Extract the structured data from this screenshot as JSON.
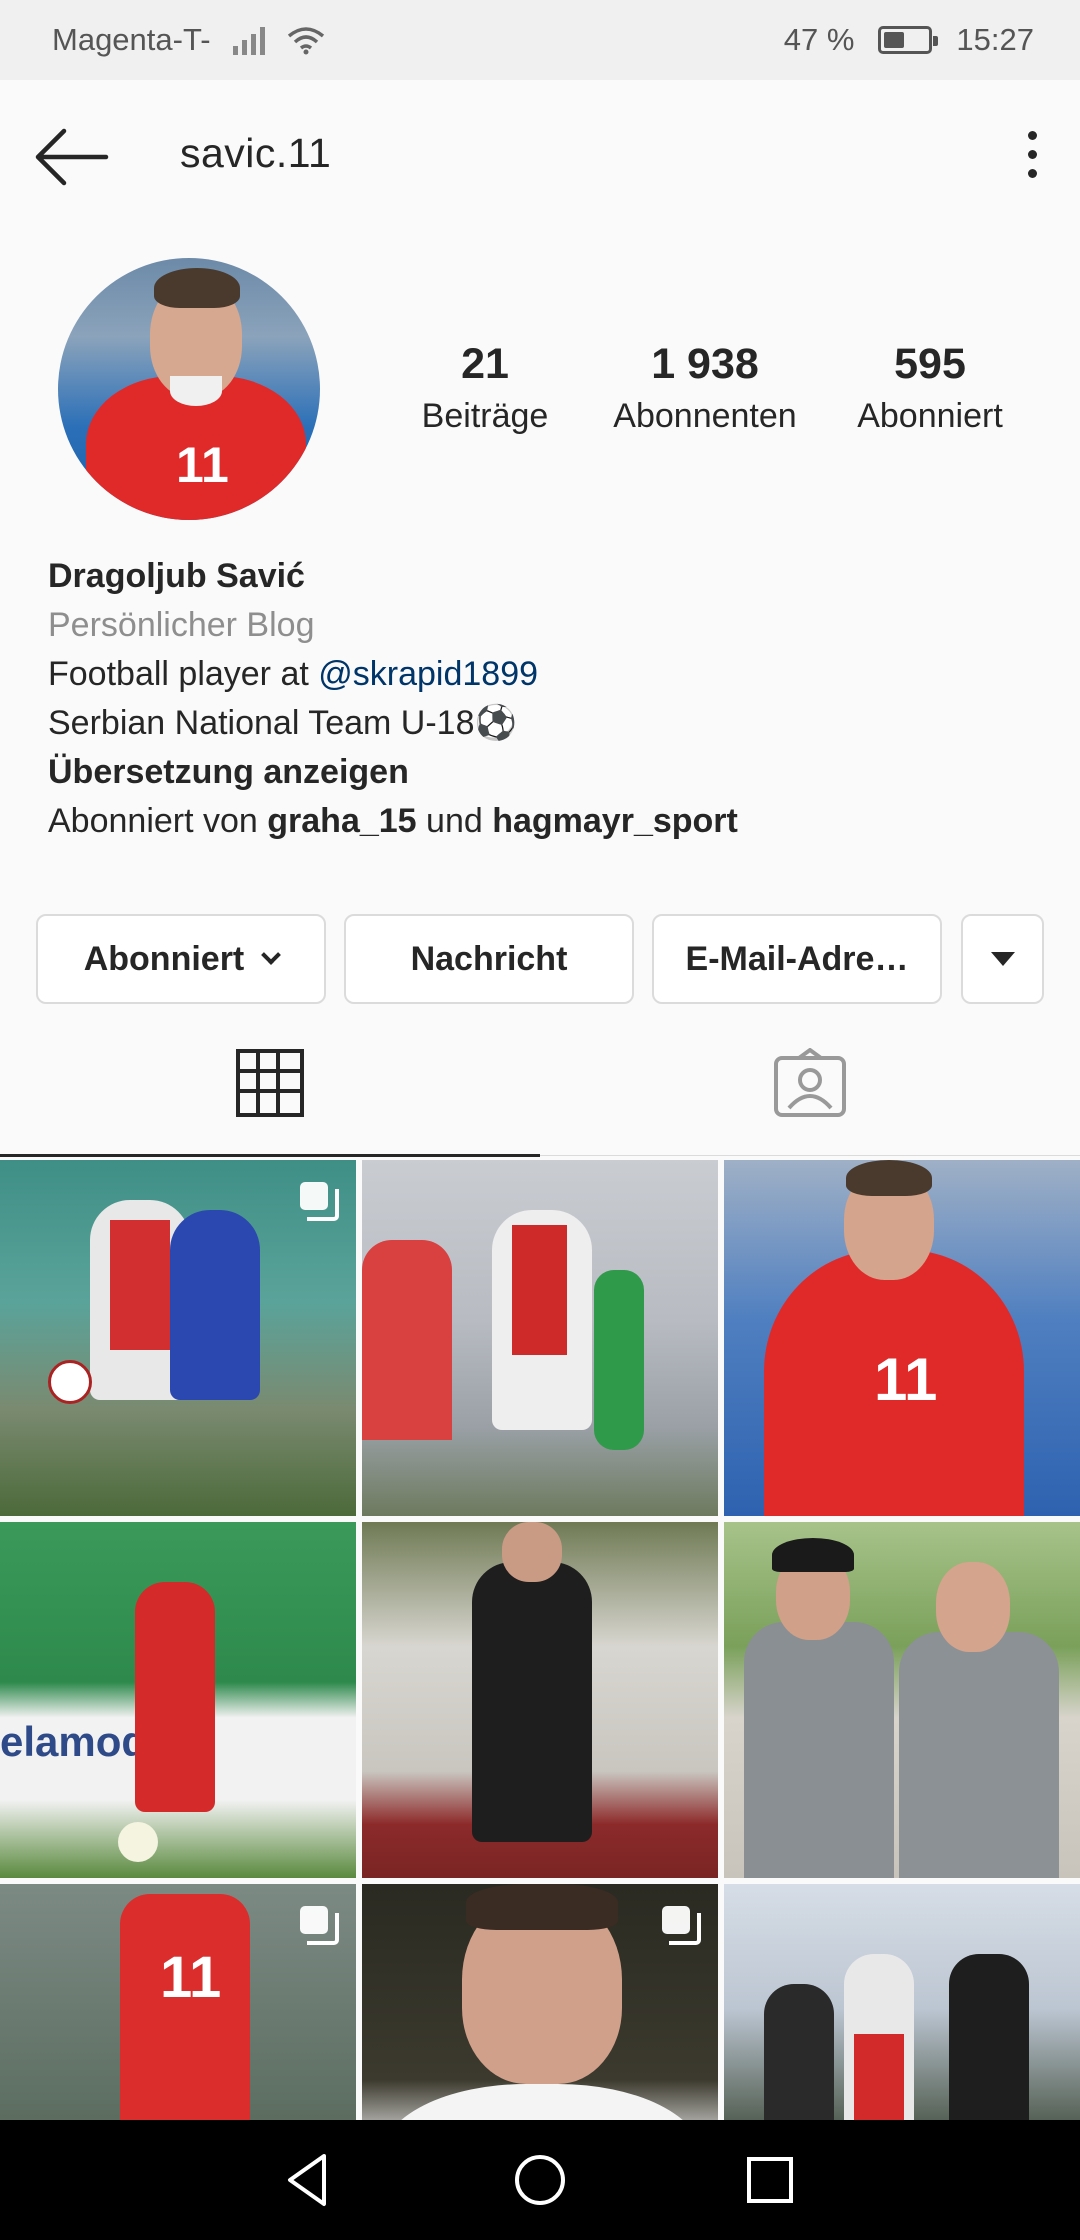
{
  "status": {
    "carrier": "Magenta-T-",
    "battery": "47 %",
    "battery_level": 0.47,
    "time": "15:27"
  },
  "header": {
    "username": "savic.11"
  },
  "stats": {
    "posts_value": "21",
    "posts_label": "Beiträge",
    "followers_value": "1 938",
    "followers_label": "Abonnenten",
    "following_value": "595",
    "following_label": "Abonniert"
  },
  "bio": {
    "name": "Dragoljub Savić",
    "category": "Persönlicher Blog",
    "line1_prefix": "Football player at ",
    "line1_link": "@skrapid1899",
    "line2": "Serbian National Team U-18⚽",
    "translate": "Übersetzung anzeigen",
    "followed_by_prefix": "Abonniert von ",
    "followed_by_user1": "graha_15",
    "followed_by_and": " und ",
    "followed_by_user2": "hagmayr_sport"
  },
  "buttons": {
    "following": "Abonniert",
    "message": "Nachricht",
    "email": "E-Mail-Adre…"
  },
  "tabs": {
    "grid": "grid-icon",
    "tagged": "tagged-photos-icon",
    "active": "grid"
  },
  "colors": {
    "link": "#003569",
    "secondary": "#8e8e8e",
    "background": "#fafafa"
  }
}
